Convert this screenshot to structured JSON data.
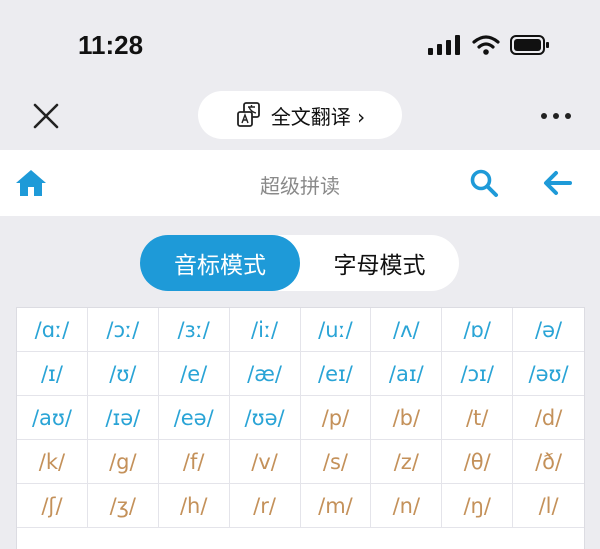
{
  "status": {
    "time": "11:28"
  },
  "nav": {
    "translate_label": "全文翻译 ›"
  },
  "header": {
    "title": "超级拼读"
  },
  "modes": {
    "phonetic": "音标模式",
    "letter": "字母模式"
  },
  "colors": {
    "accent": "#1e9ad8",
    "vowel": "#2aa4d6",
    "consonant": "#c4915a"
  },
  "phonetics": [
    {
      "symbol": "/ɑː/",
      "type": "vowel"
    },
    {
      "symbol": "/ɔː/",
      "type": "vowel"
    },
    {
      "symbol": "/ɜː/",
      "type": "vowel"
    },
    {
      "symbol": "/iː/",
      "type": "vowel"
    },
    {
      "symbol": "/uː/",
      "type": "vowel"
    },
    {
      "symbol": "/ʌ/",
      "type": "vowel"
    },
    {
      "symbol": "/ɒ/",
      "type": "vowel"
    },
    {
      "symbol": "/ə/",
      "type": "vowel"
    },
    {
      "symbol": "/ɪ/",
      "type": "vowel"
    },
    {
      "symbol": "/ʊ/",
      "type": "vowel"
    },
    {
      "symbol": "/e/",
      "type": "vowel"
    },
    {
      "symbol": "/æ/",
      "type": "vowel"
    },
    {
      "symbol": "/eɪ/",
      "type": "vowel"
    },
    {
      "symbol": "/aɪ/",
      "type": "vowel"
    },
    {
      "symbol": "/ɔɪ/",
      "type": "vowel"
    },
    {
      "symbol": "/əʊ/",
      "type": "vowel"
    },
    {
      "symbol": "/aʊ/",
      "type": "vowel"
    },
    {
      "symbol": "/ɪə/",
      "type": "vowel"
    },
    {
      "symbol": "/eə/",
      "type": "vowel"
    },
    {
      "symbol": "/ʊə/",
      "type": "vowel"
    },
    {
      "symbol": "/p/",
      "type": "consonant"
    },
    {
      "symbol": "/b/",
      "type": "consonant"
    },
    {
      "symbol": "/t/",
      "type": "consonant"
    },
    {
      "symbol": "/d/",
      "type": "consonant"
    },
    {
      "symbol": "/k/",
      "type": "consonant"
    },
    {
      "symbol": "/g/",
      "type": "consonant"
    },
    {
      "symbol": "/f/",
      "type": "consonant"
    },
    {
      "symbol": "/v/",
      "type": "consonant"
    },
    {
      "symbol": "/s/",
      "type": "consonant"
    },
    {
      "symbol": "/z/",
      "type": "consonant"
    },
    {
      "symbol": "/θ/",
      "type": "consonant"
    },
    {
      "symbol": "/ð/",
      "type": "consonant"
    },
    {
      "symbol": "/ʃ/",
      "type": "consonant"
    },
    {
      "symbol": "/ʒ/",
      "type": "consonant"
    },
    {
      "symbol": "/h/",
      "type": "consonant"
    },
    {
      "symbol": "/r/",
      "type": "consonant"
    },
    {
      "symbol": "/m/",
      "type": "consonant"
    },
    {
      "symbol": "/n/",
      "type": "consonant"
    },
    {
      "symbol": "/ŋ/",
      "type": "consonant"
    },
    {
      "symbol": "/l/",
      "type": "consonant"
    }
  ]
}
